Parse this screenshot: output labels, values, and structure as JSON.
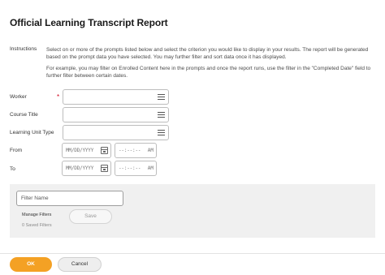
{
  "page": {
    "title": "Official Learning Transcript Report"
  },
  "instructions": {
    "label": "Instructions",
    "paragraph1": "Select on or more of the prompts listed below and select the criterion you would like to display in your results. The report will be generated based on the prompt data you have selected. You may further filter and sort data once it has displayed.",
    "paragraph2": "For example, you may filter on Enrolled Content here in the prompts and once the report runs, use the filter in the \"Completed Date\" field to further filter between certain dates."
  },
  "fields": {
    "worker": {
      "label": "Worker",
      "required_marker": "*",
      "value": ""
    },
    "course_title": {
      "label": "Course Title",
      "value": ""
    },
    "learning_unit_type": {
      "label": "Learning Unit Type",
      "value": ""
    },
    "from": {
      "label": "From",
      "date_placeholder": "MM/DD/YYYY",
      "time_placeholder": "--:--:--",
      "ampm": "AM"
    },
    "to": {
      "label": "To",
      "date_placeholder": "MM/DD/YYYY",
      "time_placeholder": "--:--:--",
      "ampm": "AM"
    }
  },
  "filter": {
    "name_placeholder": "Filter Name",
    "manage_label": "Manage Filters",
    "save_label": "Save",
    "saved_count": "0 Saved Filters"
  },
  "footer": {
    "ok_label": "OK",
    "cancel_label": "Cancel"
  },
  "colors": {
    "ok_button": "#f4a124",
    "required": "#d0021b",
    "filter_panel": "#f0f0f0"
  }
}
